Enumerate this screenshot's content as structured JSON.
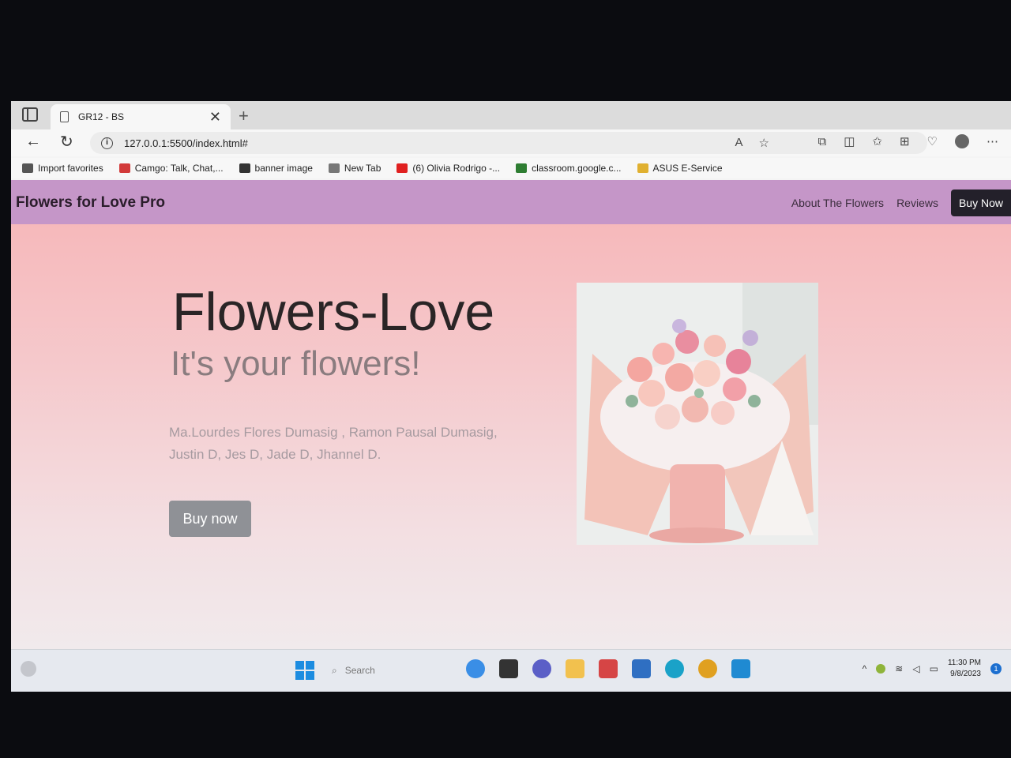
{
  "browser": {
    "tab_title": "GR12 - BS",
    "tab_close": "✕",
    "new_tab": "+",
    "url": "127.0.0.1:5500/index.html#",
    "back": "←",
    "reload": "↻"
  },
  "bookmarks": [
    {
      "label": "Import favorites",
      "color": "#555555"
    },
    {
      "label": "Camgo: Talk, Chat,...",
      "color": "#d23a3a"
    },
    {
      "label": "banner image",
      "color": "#333333"
    },
    {
      "label": "New Tab",
      "color": "#777777"
    },
    {
      "label": "(6) Olivia Rodrigo -...",
      "color": "#e02020"
    },
    {
      "label": "classroom.google.c...",
      "color": "#2e7d32"
    },
    {
      "label": "ASUS E-Service",
      "color": "#e0b030"
    }
  ],
  "site": {
    "brand": "Flowers for Love Pro",
    "nav": [
      "About The Flowers",
      "Reviews"
    ],
    "nav_buy": "Buy Now",
    "hero_title": "Flowers-Love",
    "hero_subtitle": "It's your flowers!",
    "hero_names": "Ma.Lourdes Flores Dumasig , Ramon Pausal Dumasig, Justin D, Jes D, Jade D, Jhannel D.",
    "hero_button": "Buy now"
  },
  "taskbar": {
    "search_placeholder": "Search",
    "time": "11:30 PM",
    "date": "9/8/2023",
    "notifications": "1"
  }
}
